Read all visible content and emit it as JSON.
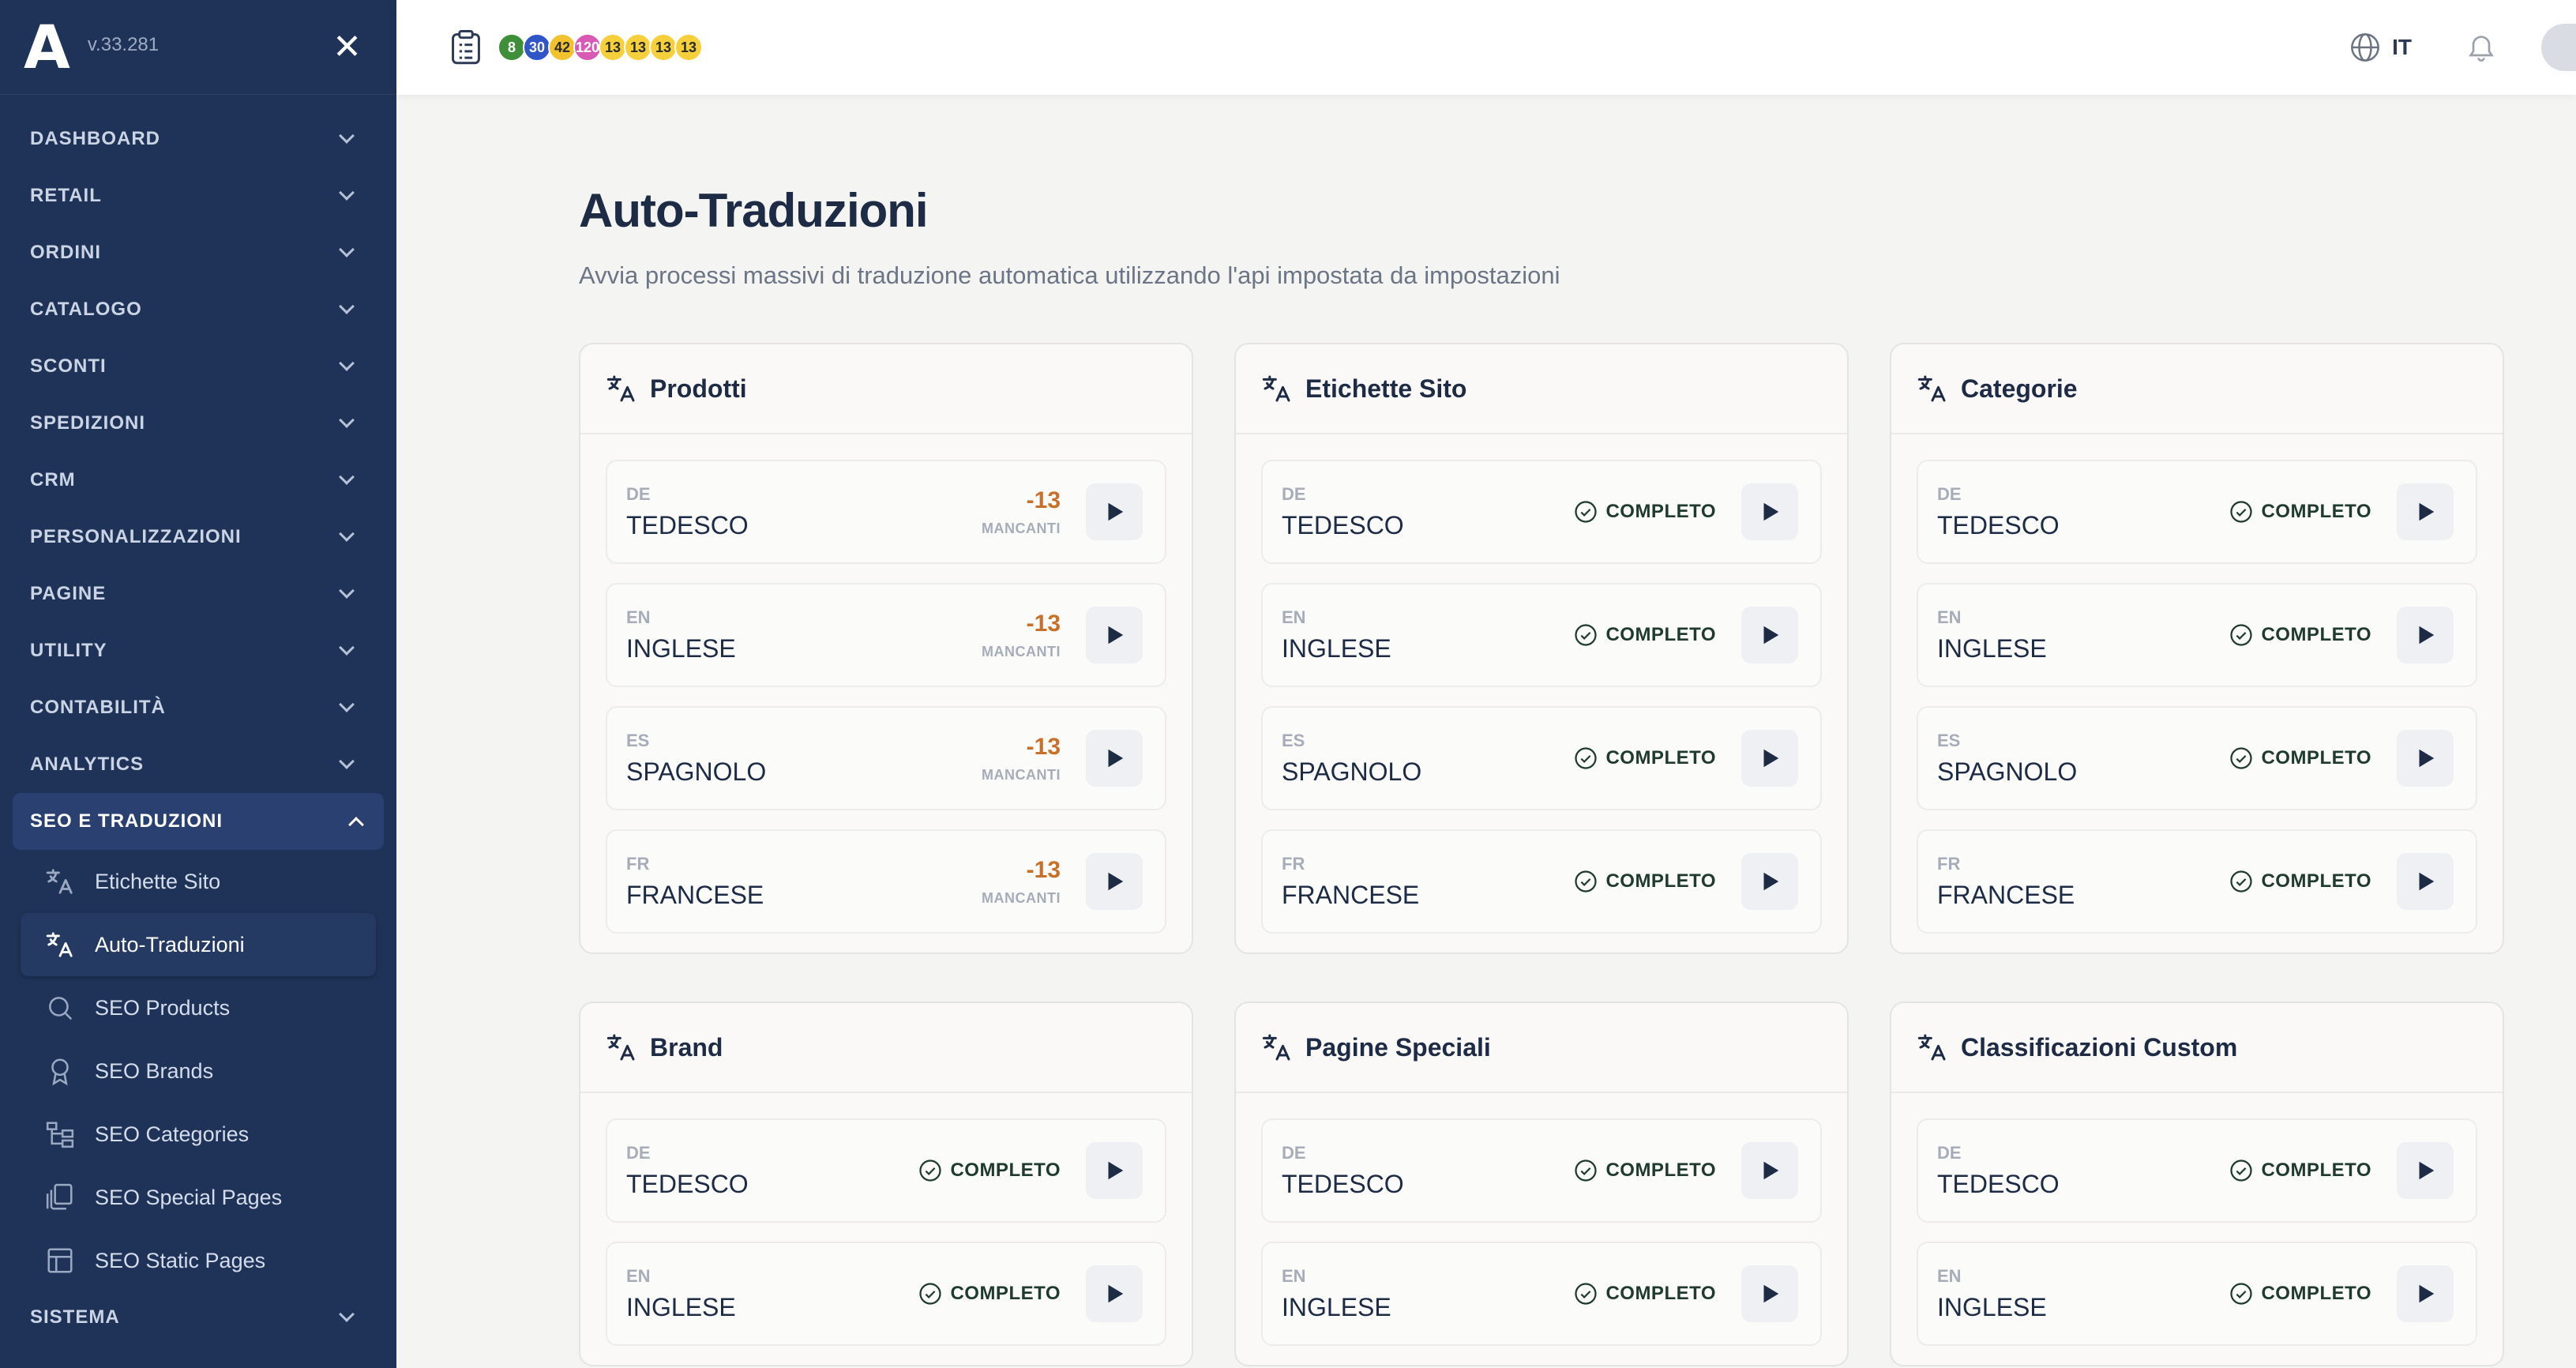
{
  "app": {
    "logo": "A",
    "version": "v.33.281"
  },
  "sidebar": {
    "menu": [
      {
        "label": "DASHBOARD"
      },
      {
        "label": "RETAIL"
      },
      {
        "label": "ORDINI"
      },
      {
        "label": "CATALOGO"
      },
      {
        "label": "SCONTI"
      },
      {
        "label": "SPEDIZIONI"
      },
      {
        "label": "CRM"
      },
      {
        "label": "PERSONALIZZAZIONI"
      },
      {
        "label": "PAGINE"
      },
      {
        "label": "UTILITY"
      },
      {
        "label": "CONTABILITÀ"
      },
      {
        "label": "ANALYTICS"
      }
    ],
    "open_section": {
      "label": "SEO E TRADUZIONI"
    },
    "sub_items": [
      {
        "label": "Etichette Sito",
        "icon": "translate-icon"
      },
      {
        "label": "Auto-Traduzioni",
        "icon": "translate-icon",
        "active": true
      },
      {
        "label": "SEO Products",
        "icon": "search-icon"
      },
      {
        "label": "SEO Brands",
        "icon": "award-icon"
      },
      {
        "label": "SEO Categories",
        "icon": "hierarchy-icon"
      },
      {
        "label": "SEO Special Pages",
        "icon": "pages-icon"
      },
      {
        "label": "SEO Static Pages",
        "icon": "layout-icon"
      }
    ],
    "last_section": {
      "label": "SISTEMA"
    }
  },
  "topbar": {
    "badges": [
      {
        "value": "8",
        "color": "#3f8f3a",
        "text": "#ffffff"
      },
      {
        "value": "30",
        "color": "#2f55c8",
        "text": "#ffffff"
      },
      {
        "value": "42",
        "color": "#f2c12e",
        "text": "#2a2a2a"
      },
      {
        "value": "120",
        "color": "#d95ab5",
        "text": "#ffffff"
      },
      {
        "value": "13",
        "color": "#f5d03a",
        "text": "#2a2a2a"
      },
      {
        "value": "13",
        "color": "#f5d03a",
        "text": "#2a2a2a"
      },
      {
        "value": "13",
        "color": "#f5d03a",
        "text": "#2a2a2a"
      },
      {
        "value": "13",
        "color": "#f5d03a",
        "text": "#2a2a2a"
      }
    ],
    "language": "IT"
  },
  "page": {
    "title": "Auto-Traduzioni",
    "subtitle": "Avvia processi massivi di traduzione automatica utilizzando l'api impostata da impostazioni"
  },
  "status_labels": {
    "complete": "COMPLETO",
    "missing": "MANCANTI"
  },
  "cards": [
    {
      "title": "Prodotti",
      "rows": [
        {
          "code": "DE",
          "name": "TEDESCO",
          "status": "missing",
          "count": "-13"
        },
        {
          "code": "EN",
          "name": "INGLESE",
          "status": "missing",
          "count": "-13"
        },
        {
          "code": "ES",
          "name": "SPAGNOLO",
          "status": "missing",
          "count": "-13"
        },
        {
          "code": "FR",
          "name": "FRANCESE",
          "status": "missing",
          "count": "-13"
        }
      ]
    },
    {
      "title": "Etichette Sito",
      "rows": [
        {
          "code": "DE",
          "name": "TEDESCO",
          "status": "complete"
        },
        {
          "code": "EN",
          "name": "INGLESE",
          "status": "complete"
        },
        {
          "code": "ES",
          "name": "SPAGNOLO",
          "status": "complete"
        },
        {
          "code": "FR",
          "name": "FRANCESE",
          "status": "complete"
        }
      ]
    },
    {
      "title": "Categorie",
      "rows": [
        {
          "code": "DE",
          "name": "TEDESCO",
          "status": "complete"
        },
        {
          "code": "EN",
          "name": "INGLESE",
          "status": "complete"
        },
        {
          "code": "ES",
          "name": "SPAGNOLO",
          "status": "complete"
        },
        {
          "code": "FR",
          "name": "FRANCESE",
          "status": "complete"
        }
      ]
    },
    {
      "title": "Brand",
      "rows": [
        {
          "code": "DE",
          "name": "TEDESCO",
          "status": "complete"
        },
        {
          "code": "EN",
          "name": "INGLESE",
          "status": "complete"
        }
      ]
    },
    {
      "title": "Pagine Speciali",
      "rows": [
        {
          "code": "DE",
          "name": "TEDESCO",
          "status": "complete"
        },
        {
          "code": "EN",
          "name": "INGLESE",
          "status": "complete"
        }
      ]
    },
    {
      "title": "Classificazioni Custom",
      "rows": [
        {
          "code": "DE",
          "name": "TEDESCO",
          "status": "complete"
        },
        {
          "code": "EN",
          "name": "INGLESE",
          "status": "complete"
        }
      ]
    }
  ]
}
